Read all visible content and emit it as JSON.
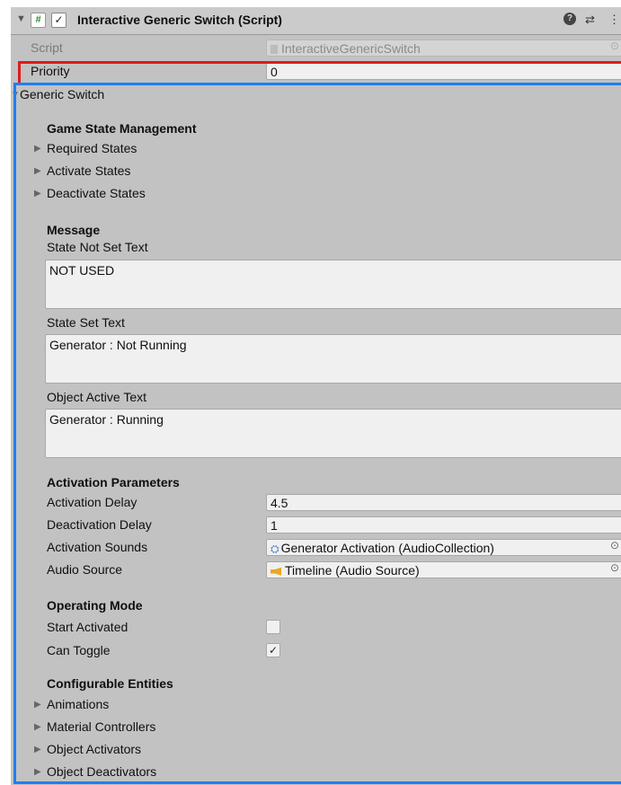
{
  "header": {
    "script_icon": "#",
    "enabled_check": "✓",
    "title": "Interactive Generic Switch (Script)",
    "help_icon": "?",
    "preset_icon": "⇄",
    "menu_icon": "⋮"
  },
  "script_row": {
    "label": "Script",
    "value": "InteractiveGenericSwitch"
  },
  "priority_row": {
    "label": "Priority",
    "value": "0"
  },
  "generic_switch": {
    "label": "Generic Switch",
    "game_state": {
      "title": "Game State Management",
      "items": [
        "Required States",
        "Activate States",
        "Deactivate States"
      ]
    },
    "message": {
      "title": "Message",
      "state_not_set_label": "State Not Set Text",
      "state_not_set_value": "NOT USED",
      "state_set_label": "State Set Text",
      "state_set_value": "Generator : Not Running",
      "object_active_label": "Object Active Text",
      "object_active_value": "Generator : Running"
    },
    "activation": {
      "title": "Activation Parameters",
      "delay_label": "Activation Delay",
      "delay_value": "4.5",
      "deactivation_label": "Deactivation Delay",
      "deactivation_value": "1",
      "sounds_label": "Activation Sounds",
      "sounds_value": "Generator Activation (AudioCollection)",
      "audio_label": "Audio Source",
      "audio_value": "Timeline (Audio Source)"
    },
    "operating": {
      "title": "Operating Mode",
      "start_activated_label": "Start Activated",
      "start_activated_checked": false,
      "can_toggle_label": "Can Toggle",
      "can_toggle_mark": "✓"
    },
    "entities": {
      "title": "Configurable Entities",
      "items": [
        "Animations",
        "Material Controllers",
        "Object Activators",
        "Object Deactivators"
      ]
    }
  },
  "colors": {
    "inspector_bg": "#c2c2c2",
    "highlight_red": "#e01b1b",
    "highlight_blue": "#1f7ff0"
  }
}
